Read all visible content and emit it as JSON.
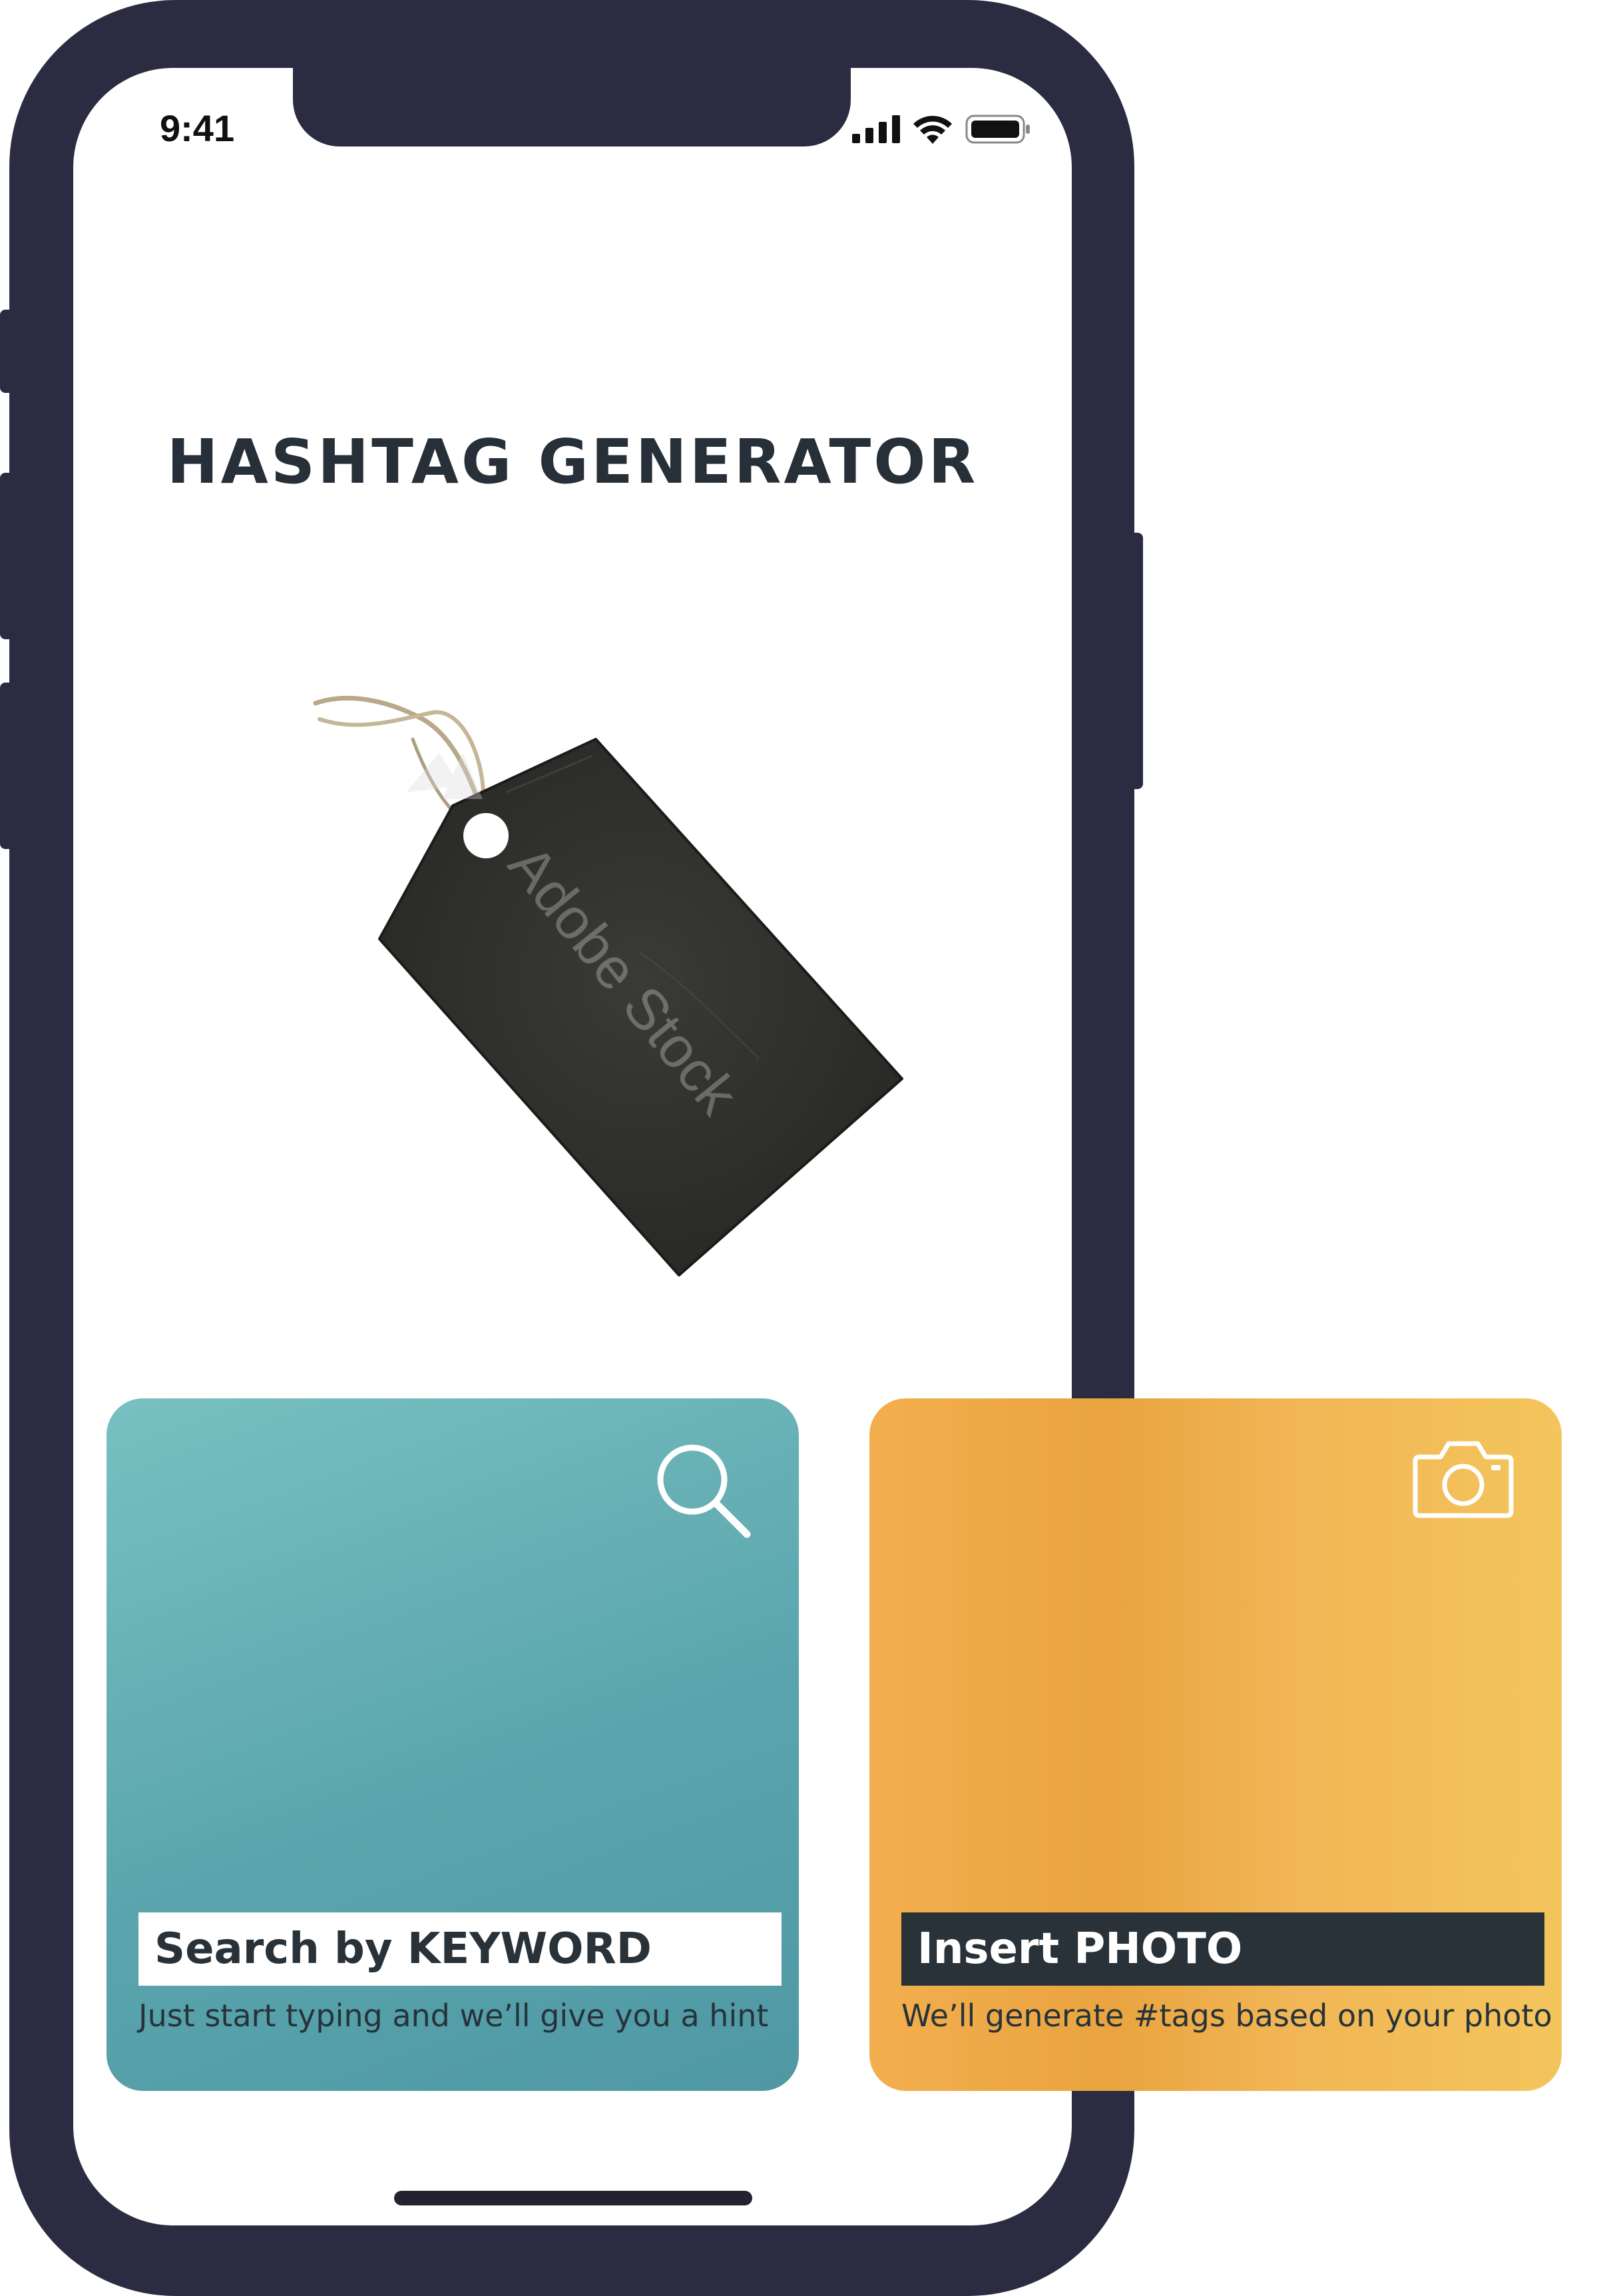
{
  "status_bar": {
    "time": "9:41",
    "icons": [
      "cellular-signal-icon",
      "wifi-icon",
      "battery-icon"
    ]
  },
  "app": {
    "title": "HASHTAG GENERATOR",
    "hero_image": {
      "name": "price-tag-image",
      "watermark": "Adobe Stock"
    }
  },
  "cards": {
    "search": {
      "label": "Search by KEYWORD",
      "description": "Just start typing and we’ll give you a hint",
      "icon": "search-icon",
      "color": "#5fa9b0"
    },
    "photo": {
      "label": "Insert PHOTO",
      "description": "We’ll generate #tags based on your photo",
      "icon": "camera-icon",
      "color": "#f2b24e"
    }
  },
  "colors": {
    "frame": "#2b2c42",
    "title_text": "#273038",
    "dark_label": "#283238"
  }
}
